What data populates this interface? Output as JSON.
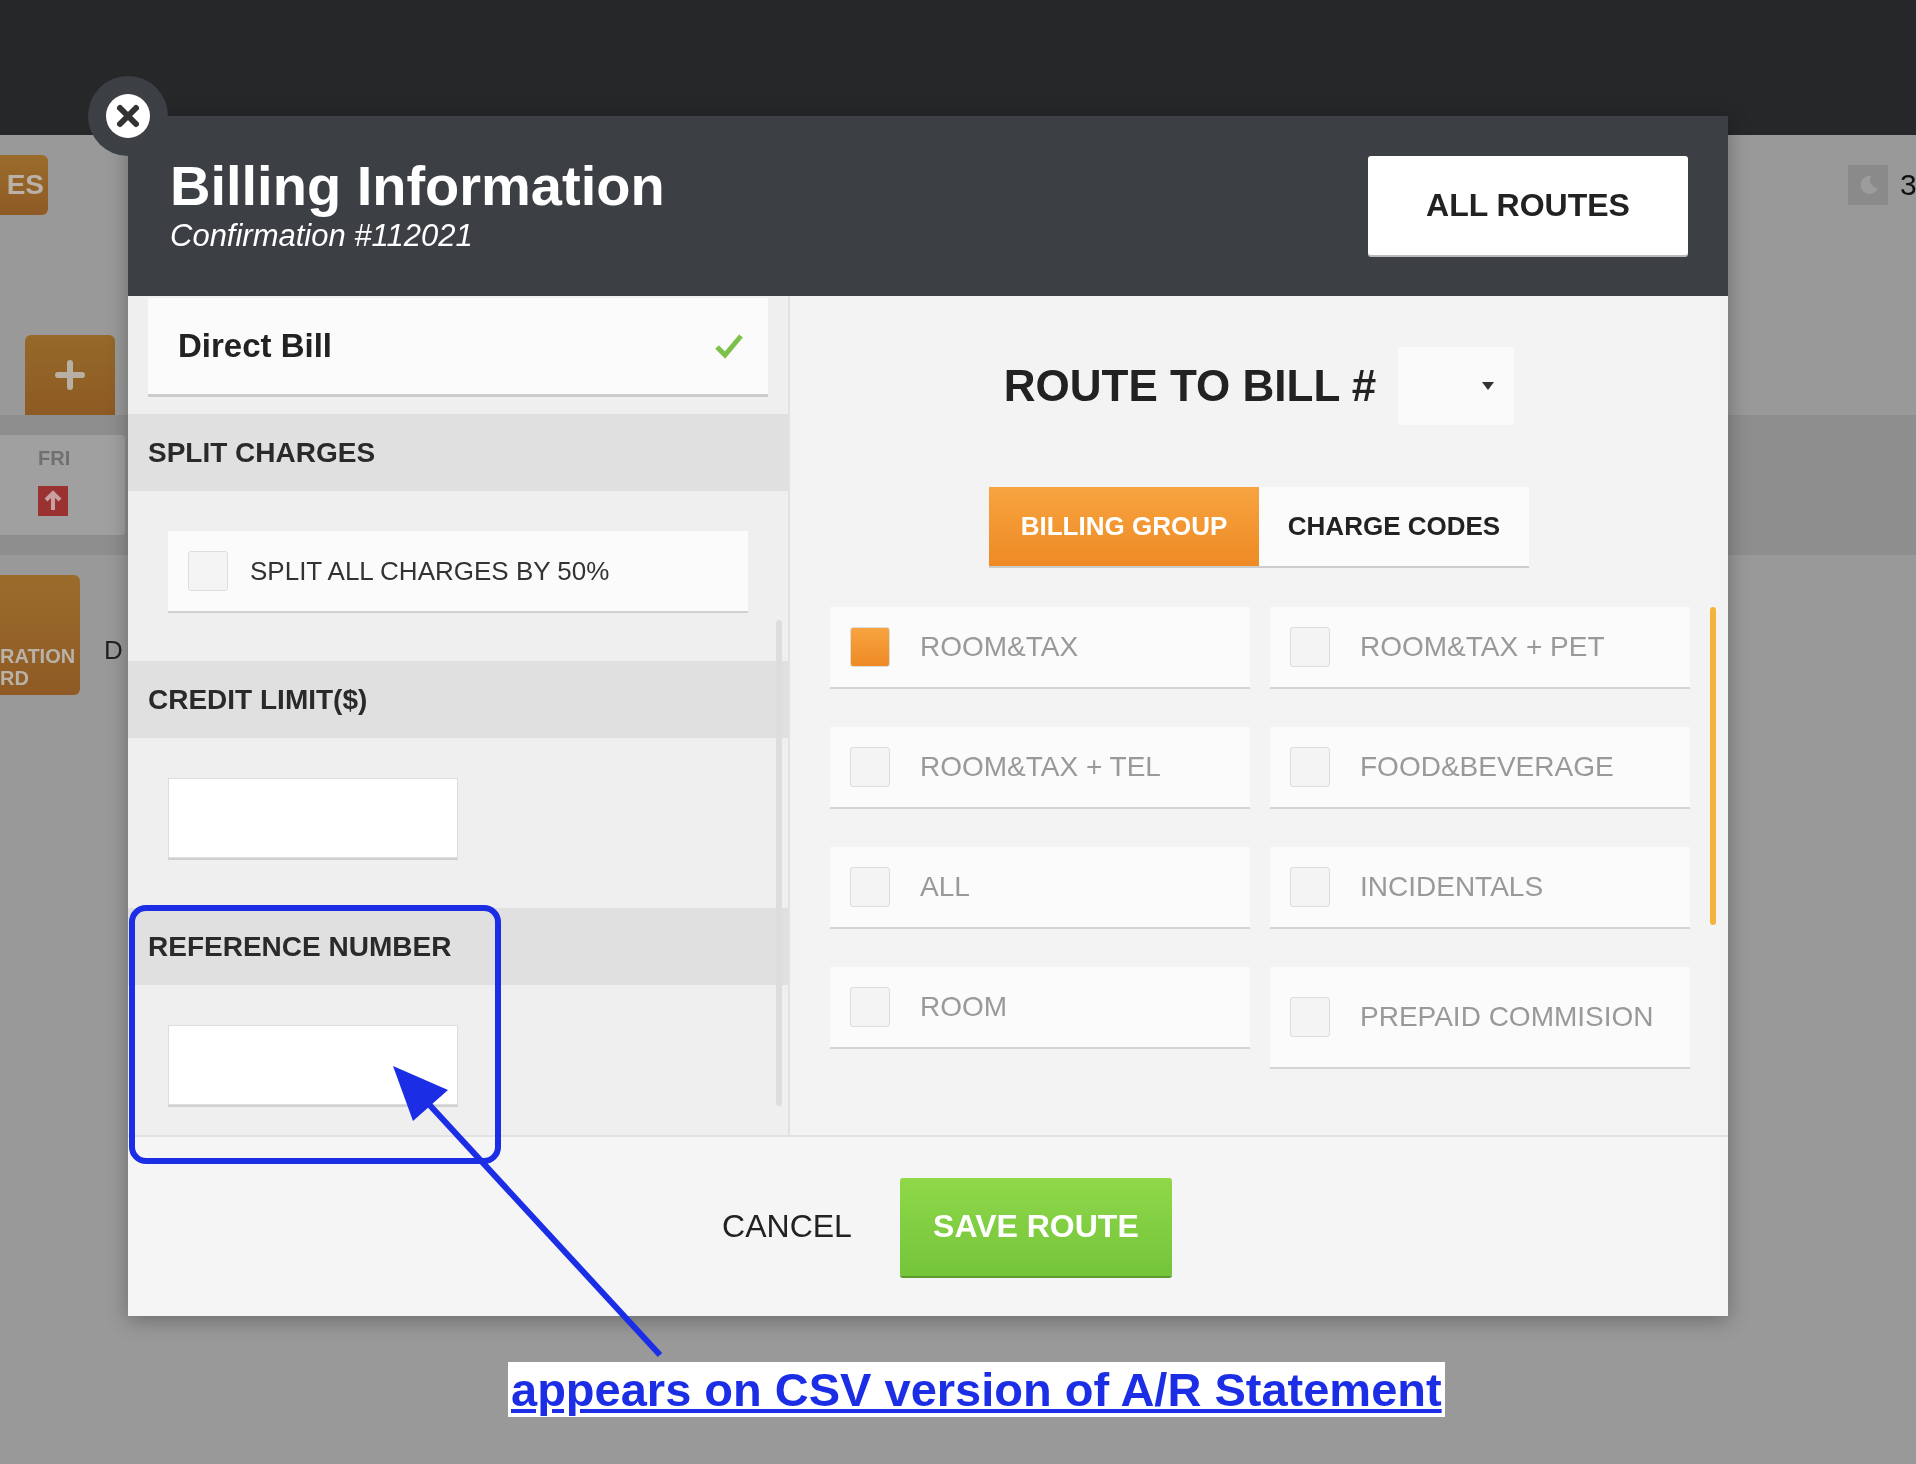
{
  "background": {
    "side_button": "ES",
    "day_card": {
      "day": "FRI"
    },
    "side_card": {
      "lines": [
        "RATION",
        "RD"
      ]
    },
    "label": "D",
    "night_count": "3"
  },
  "dialog": {
    "title": "Billing Information",
    "subtitle": "Confirmation #112021",
    "all_routes_button": "ALL ROUTES",
    "bill_type": {
      "label": "Direct Bill",
      "checked": true
    },
    "sections": [
      {
        "kind": "checkbox",
        "heading": "SPLIT CHARGES",
        "label": "SPLIT ALL CHARGES BY 50%",
        "checked": false
      },
      {
        "kind": "input",
        "heading": "CREDIT LIMIT($)"
      },
      {
        "kind": "input",
        "heading": "REFERENCE NUMBER"
      }
    ],
    "route_label": "ROUTE TO BILL #",
    "tabs": [
      {
        "label": "BILLING GROUP",
        "selected": true
      },
      {
        "label": "CHARGE CODES",
        "selected": false
      }
    ],
    "groups": [
      {
        "label": "ROOM&TAX",
        "checked": true
      },
      {
        "label": "ROOM&TAX + PET",
        "checked": false
      },
      {
        "label": "ROOM&TAX + TEL",
        "checked": false
      },
      {
        "label": "FOOD&BEVERAGE",
        "checked": false
      },
      {
        "label": "ALL",
        "checked": false
      },
      {
        "label": "INCIDENTALS",
        "checked": false
      },
      {
        "label": "ROOM",
        "checked": false
      },
      {
        "label": "PREPAID COMMISION",
        "checked": false
      }
    ],
    "cancel_button": "CANCEL",
    "save_button": "SAVE ROUTE"
  },
  "annotation": {
    "text": "appears on CSV version of A/R Statement"
  }
}
